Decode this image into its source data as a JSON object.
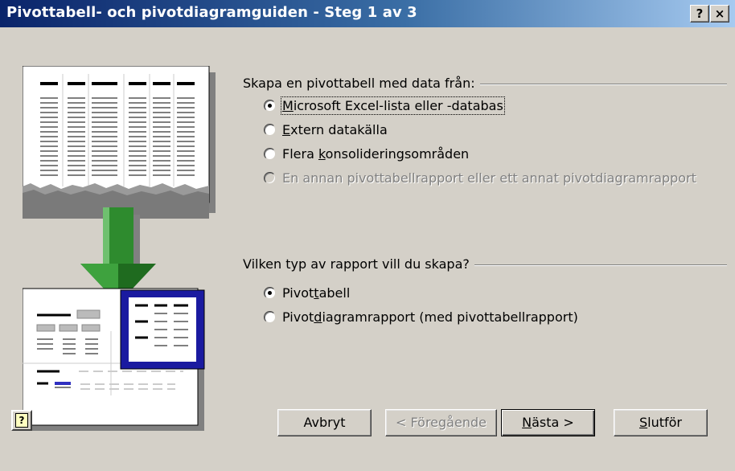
{
  "window": {
    "title": "Pivottabell- och pivotdiagramguiden - Steg 1 av 3",
    "help_btn": "?",
    "close_btn": "×"
  },
  "source_group": {
    "label": "Skapa en pivottabell med data från:",
    "options": [
      {
        "pre": "",
        "u": "M",
        "post": "icrosoft Excel-lista eller -databas",
        "checked": true,
        "disabled": false
      },
      {
        "pre": "",
        "u": "E",
        "post": "xtern datakälla",
        "checked": false,
        "disabled": false
      },
      {
        "pre": "Flera ",
        "u": "k",
        "post": "onsolideringsområden",
        "checked": false,
        "disabled": false
      },
      {
        "pre": "En annan pivottabellrapport eller ett annat pivotdiagramrapport",
        "u": "",
        "post": "",
        "checked": false,
        "disabled": true
      }
    ]
  },
  "report_group": {
    "label": "Vilken typ av rapport vill du skapa?",
    "options": [
      {
        "pre": "Pivot",
        "u": "t",
        "post": "abell",
        "checked": true,
        "disabled": false
      },
      {
        "pre": "Pivot",
        "u": "d",
        "post": "iagramrapport (med pivottabellrapport)",
        "checked": false,
        "disabled": false
      }
    ]
  },
  "buttons": {
    "cancel": "Avbryt",
    "back": "< Föregående",
    "next_u": "N",
    "next_rest": "ästa >",
    "finish_u": "S",
    "finish_rest": "lutför"
  },
  "icons": {
    "help": "help-question-icon",
    "illustration": "pivot-wizard-illustration"
  }
}
